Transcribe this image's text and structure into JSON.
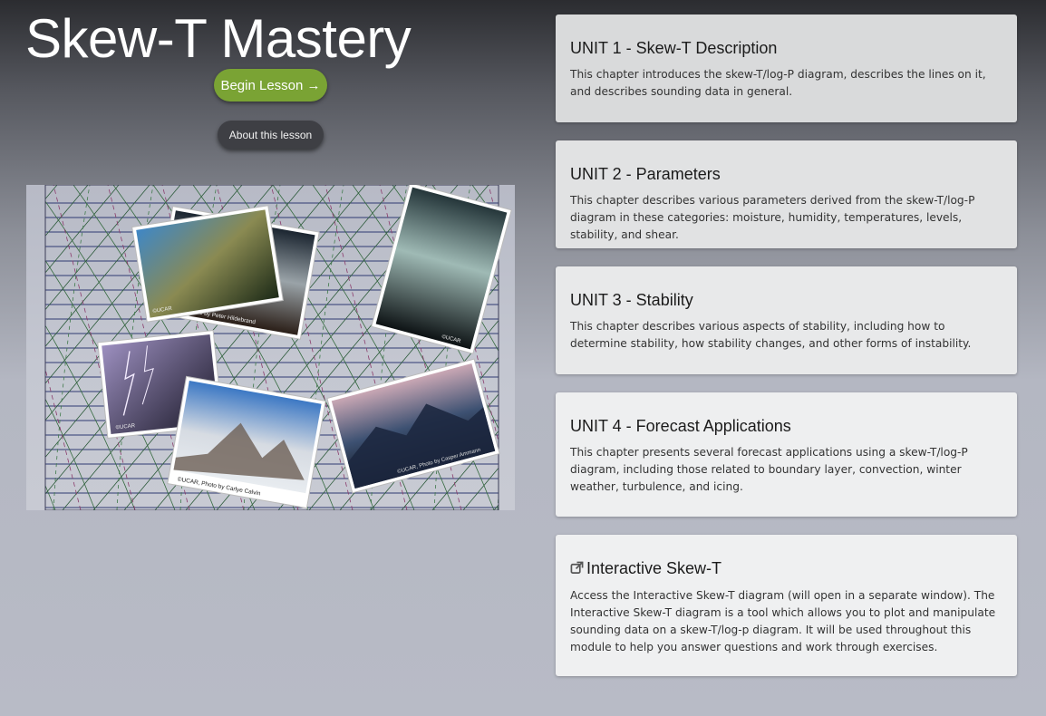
{
  "header": {
    "title": "Skew-T Mastery"
  },
  "actions": {
    "begin_label": "Begin Lesson →",
    "about_label": "About this lesson"
  },
  "hero": {
    "photo_credits": [
      "©UCAR",
      "©UCAR, Photo by Peter Hildebrand",
      "©UCAR",
      "©UCAR",
      "©UCAR, Photo by Carlye Calvin",
      "©UCAR, Photo by Casper Ammann"
    ]
  },
  "units": [
    {
      "title": "UNIT 1 - Skew-T Description",
      "description": "This chapter introduces the skew-T/log-P diagram, describes the lines on it, and describes sounding data in general."
    },
    {
      "title": "UNIT 2 - Parameters",
      "description": "This chapter describes various parameters derived from the skew-T/log-P diagram in these categories: moisture, humidity, temperatures, levels, stability, and shear."
    },
    {
      "title": "UNIT 3 - Stability",
      "description": "This chapter describes various aspects of stability, including how to determine stability, how stability changes, and other forms of instability."
    },
    {
      "title": "UNIT 4 - Forecast Applications",
      "description": "This chapter presents several forecast applications using a skew-T/log-P diagram, including those related to boundary layer, convection, winter weather, turbulence, and icing."
    }
  ],
  "interactive": {
    "icon": "external-link-icon",
    "title": "Interactive Skew-T",
    "description": "Access the Interactive Skew-T diagram (will open in a separate window). The Interactive Skew-T diagram is a tool which allows you to plot and manipulate sounding data on a skew-T/log-p diagram. It will be used throughout this module to help you answer questions and work through exercises."
  }
}
